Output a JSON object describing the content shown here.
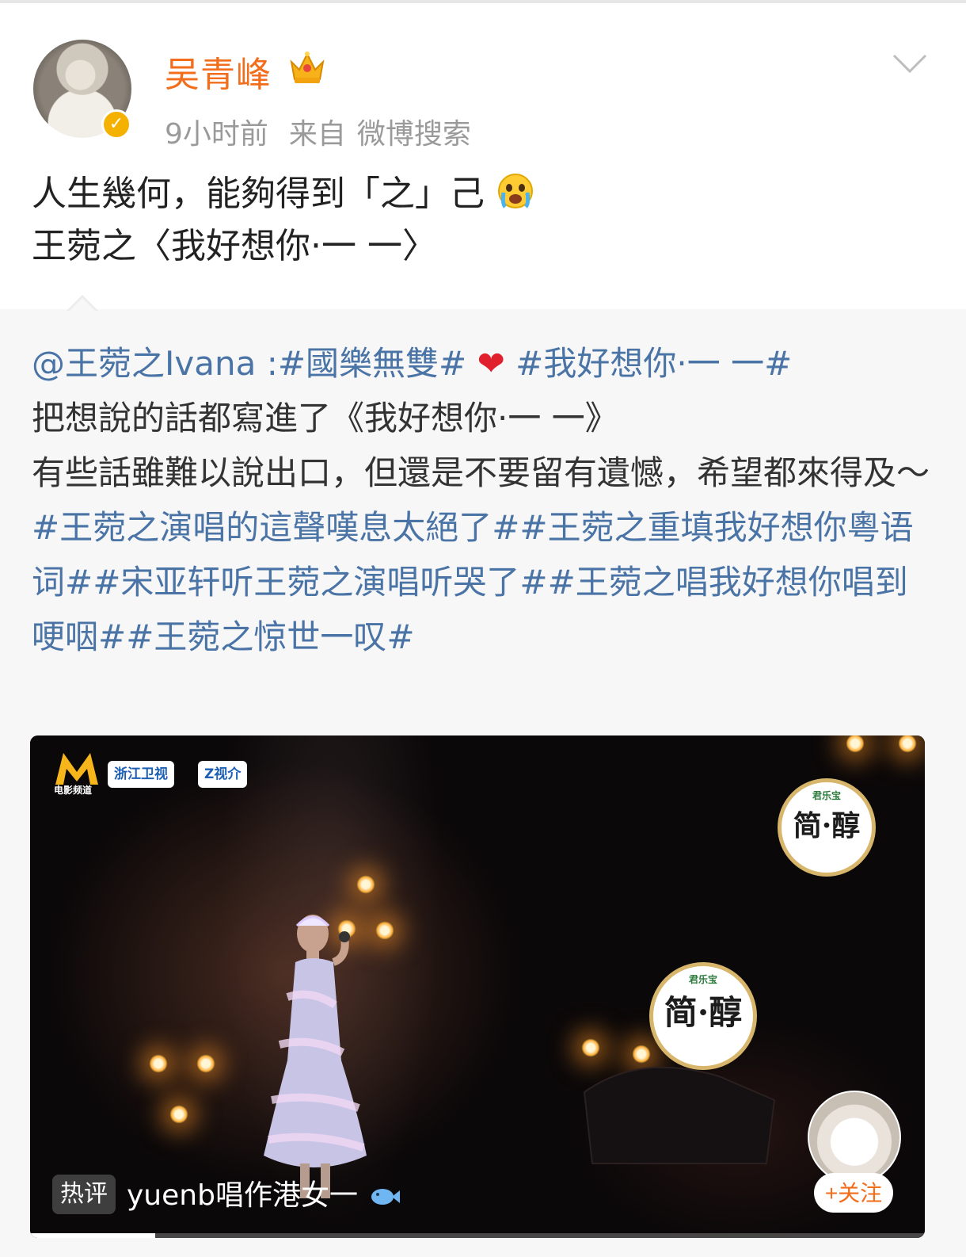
{
  "post": {
    "author": "吴青峰",
    "time": "9小时前",
    "source_prefix": "来自",
    "source": "微博搜索",
    "text": "人生幾何，能夠得到「之」己",
    "text_suffix": "王菀之〈我好想你·一 一〉"
  },
  "repost": {
    "mention": "@王菀之Ivana",
    "colon": " :",
    "tag1": "#國樂無雙#",
    "tag2": "#我好想你·一 一#",
    "line2": "把想說的話都寫進了《我好想你·一 一》",
    "line3": "有些話雖難以說出口，但還是不要留有遺憾，希望都來得及～",
    "topics": "#王菀之演唱的這聲嘆息太絕了##王菀之重填我好想你粵语词##宋亚轩听王菀之演唱听哭了##王菀之唱我好想你唱到哽咽##王菀之惊世一叹#"
  },
  "video": {
    "channel_label": "电影频道",
    "tv1": "浙江卫视",
    "tv2": "Z视介",
    "ad_brand": "君乐宝",
    "ad_name": "简·醇",
    "hot_tag": "热评",
    "hot_comment": "yuenb唱作港女一",
    "follow": "+关注",
    "progress": 0.14
  },
  "colors": {
    "username": "#f26d1c",
    "link": "#4a73a6",
    "meta": "#9a9a9a",
    "badge": "#f5b100"
  },
  "icons": [
    "crown-icon",
    "verified-icon",
    "chevron-down-icon",
    "crying-emoji-icon",
    "heart-icon",
    "fish-emoji-icon"
  ]
}
